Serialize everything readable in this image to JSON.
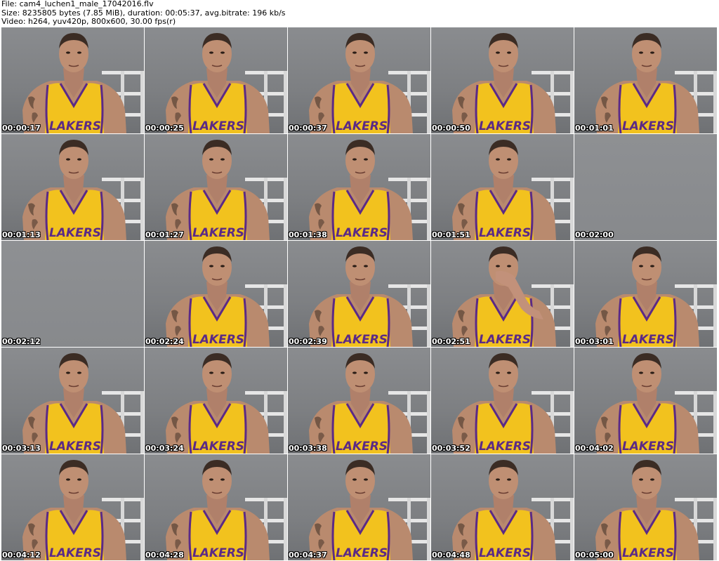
{
  "header": {
    "file_line": "File: cam4_luchen1_male_17042016.flv",
    "size_line": "Size: 8235805 bytes (7.85 MiB), duration: 00:05:37, avg.bitrate: 196 kb/s",
    "video_line": "Video: h264, yuv420p, 800x600, 30.00 fps(r)"
  },
  "jersey_text": "LAKERS",
  "colors": {
    "jersey": "#f2c21e",
    "trim": "#5b2a86",
    "skin": "#b98a6e",
    "wall": "#85878a"
  },
  "thumbnails": [
    {
      "timestamp": "00:00:17",
      "content": "person"
    },
    {
      "timestamp": "00:00:25",
      "content": "person"
    },
    {
      "timestamp": "00:00:37",
      "content": "person"
    },
    {
      "timestamp": "00:00:50",
      "content": "person"
    },
    {
      "timestamp": "00:01:01",
      "content": "person"
    },
    {
      "timestamp": "00:01:13",
      "content": "person"
    },
    {
      "timestamp": "00:01:27",
      "content": "person"
    },
    {
      "timestamp": "00:01:38",
      "content": "person"
    },
    {
      "timestamp": "00:01:51",
      "content": "person"
    },
    {
      "timestamp": "00:02:00",
      "content": "empty"
    },
    {
      "timestamp": "00:02:12",
      "content": "empty"
    },
    {
      "timestamp": "00:02:24",
      "content": "person"
    },
    {
      "timestamp": "00:02:39",
      "content": "person"
    },
    {
      "timestamp": "00:02:51",
      "content": "person-hand"
    },
    {
      "timestamp": "00:03:01",
      "content": "person"
    },
    {
      "timestamp": "00:03:13",
      "content": "person"
    },
    {
      "timestamp": "00:03:24",
      "content": "person"
    },
    {
      "timestamp": "00:03:38",
      "content": "person"
    },
    {
      "timestamp": "00:03:52",
      "content": "person"
    },
    {
      "timestamp": "00:04:02",
      "content": "person"
    },
    {
      "timestamp": "00:04:12",
      "content": "person"
    },
    {
      "timestamp": "00:04:28",
      "content": "person"
    },
    {
      "timestamp": "00:04:37",
      "content": "person"
    },
    {
      "timestamp": "00:04:48",
      "content": "person"
    },
    {
      "timestamp": "00:05:00",
      "content": "person"
    }
  ]
}
